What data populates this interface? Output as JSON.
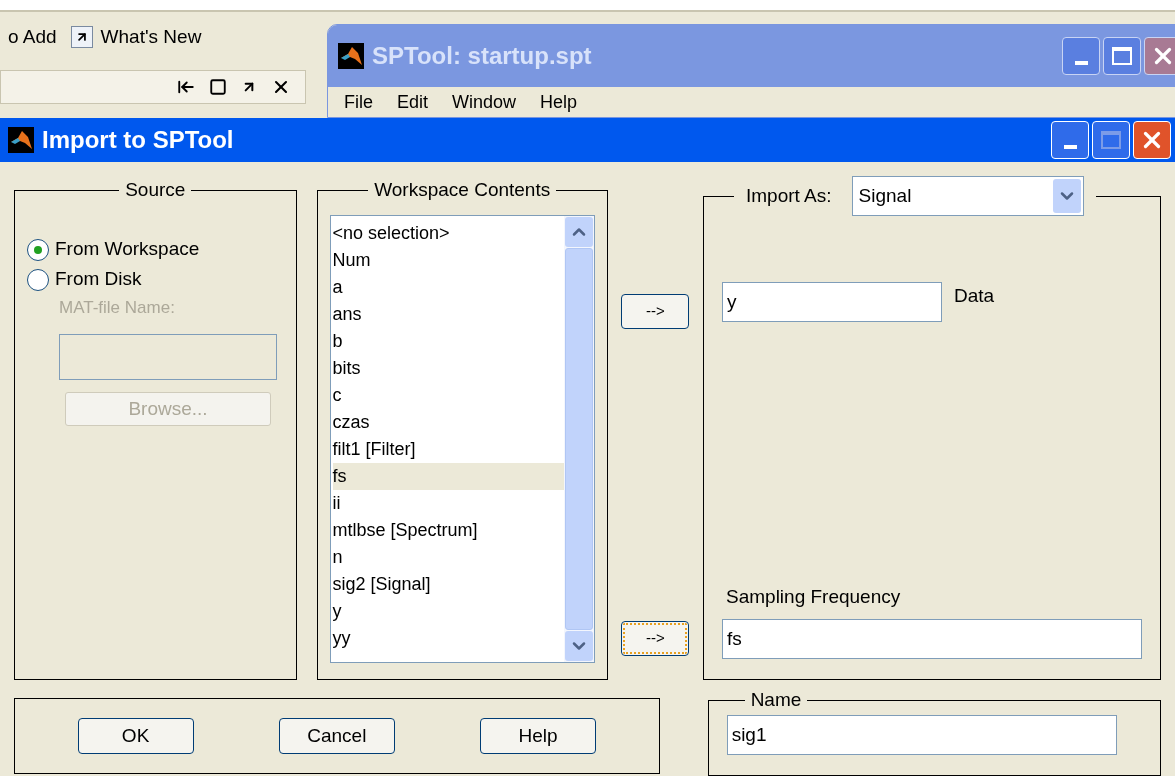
{
  "desktop": {
    "shortcuts": [
      {
        "label": "o Add",
        "kind": "text"
      },
      {
        "label": "What's New",
        "kind": "link"
      }
    ]
  },
  "sptool_window": {
    "title": "SPTool: startup.spt",
    "active": false,
    "menu": [
      "File",
      "Edit",
      "Window",
      "Help"
    ]
  },
  "dialog": {
    "title": "Import to SPTool",
    "active": true,
    "source": {
      "title": "Source",
      "options": [
        {
          "label": "From Workspace",
          "selected": true
        },
        {
          "label": "From Disk",
          "selected": false
        }
      ],
      "file_label": "MAT-file Name:",
      "disabled": true,
      "browse": "Browse..."
    },
    "workspace": {
      "title": "Workspace Contents",
      "items": [
        {
          "label": "<no selection>",
          "selected": false
        },
        {
          "label": "Num",
          "selected": false
        },
        {
          "label": "a",
          "selected": false
        },
        {
          "label": "ans",
          "selected": false
        },
        {
          "label": "b",
          "selected": false
        },
        {
          "label": "bits",
          "selected": false
        },
        {
          "label": "c",
          "selected": false
        },
        {
          "label": "czas",
          "selected": false
        },
        {
          "label": "filt1 [Filter]",
          "selected": false
        },
        {
          "label": "fs",
          "selected": true
        },
        {
          "label": "ii",
          "selected": false
        },
        {
          "label": "mtlbse [Spectrum]",
          "selected": false
        },
        {
          "label": "n",
          "selected": false
        },
        {
          "label": "sig2 [Signal]",
          "selected": false
        },
        {
          "label": "y",
          "selected": false
        },
        {
          "label": "yy",
          "selected": false
        }
      ]
    },
    "arrow_buttons": [
      {
        "label": "-->",
        "focused": false
      },
      {
        "label": "-->",
        "focused": true
      }
    ],
    "import_as": {
      "label": "Import As:",
      "value": "Signal"
    },
    "data": {
      "value": "y",
      "label": "Data"
    },
    "sampling": {
      "label": "Sampling Frequency",
      "value": "fs"
    },
    "buttons": [
      "OK",
      "Cancel",
      "Help"
    ],
    "name": {
      "title": "Name",
      "value": "sig1"
    }
  }
}
